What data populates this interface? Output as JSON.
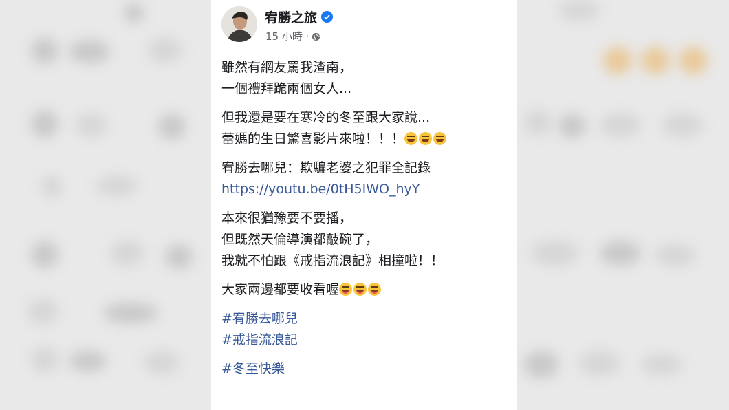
{
  "post": {
    "author": "宥勝之旅",
    "verified_icon": "verified-badge-icon",
    "time": "15 小時 ·",
    "audience_icon": "globe-icon",
    "paragraphs": [
      [
        "雖然有網友罵我渣南，",
        "一個禮拜跪兩個女人..."
      ],
      [
        "但我還是要在寒冷的冬至跟大家說...",
        "蕾媽的生日驚喜影片來啦！！！"
      ],
      [
        "宥勝去哪兒：欺騙老婆之犯罪全記錄"
      ],
      [
        "本來很猶豫要不要播，",
        "但既然天倫導演都敲碗了，",
        "我就不怕跟《戒指流浪記》相撞啦！！"
      ],
      [
        "大家兩邊都要收看喔"
      ]
    ],
    "link": "https://youtu.be/0tH5IWO_hyY",
    "hashtags": [
      "#宥勝去哪兒",
      "#戒指流浪記",
      "#冬至快樂"
    ],
    "accent_color": "#385898"
  }
}
